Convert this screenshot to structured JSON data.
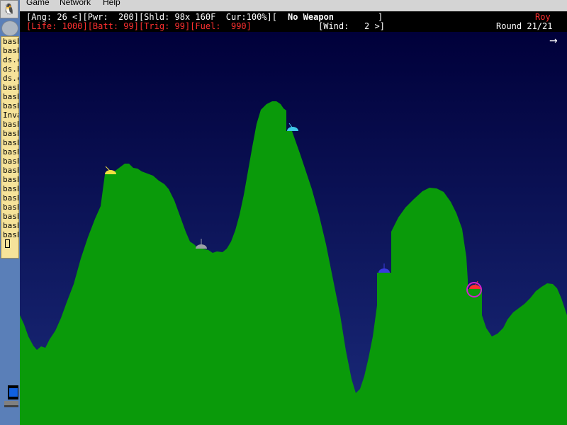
{
  "menu": {
    "items": [
      "Game",
      "Network",
      "Help"
    ]
  },
  "status": {
    "line1": "[Ang: 26 <][Pwr:  200][Shld: 98x 160F  Cur:100%][",
    "weapon": "No Weapon",
    "weapon_close": "]",
    "player": "Roy",
    "line2": "[Life: 1000][Batt: 99][Trig: 99][Fuel:  990]",
    "wind": "[Wind:   2 >]",
    "round": "Round 21/21"
  },
  "wind_arrow": "→",
  "taskbar": {
    "terminal_entries": [
      "bash",
      "bash",
      "ds.c",
      "ds.h",
      "ds.c",
      "bash",
      "bash",
      "bash",
      "Inva",
      "bash",
      "bash",
      "bash",
      "bash",
      "bash",
      "bash",
      "bash",
      "bash",
      "bash",
      "bash",
      "bash",
      "bash",
      "bash"
    ]
  },
  "tanks": [
    {
      "color": "#f0e040"
    },
    {
      "color": "#9aa0a6"
    },
    {
      "color": "#40c8e8"
    },
    {
      "color": "#3a3ae0"
    },
    {
      "color": "#ff3030"
    }
  ],
  "colors": {
    "sky_top": "#00003a",
    "sky_bottom": "#1a2a7a",
    "terrain": "#0a9a0a",
    "selection_ring": "#d020d0"
  }
}
